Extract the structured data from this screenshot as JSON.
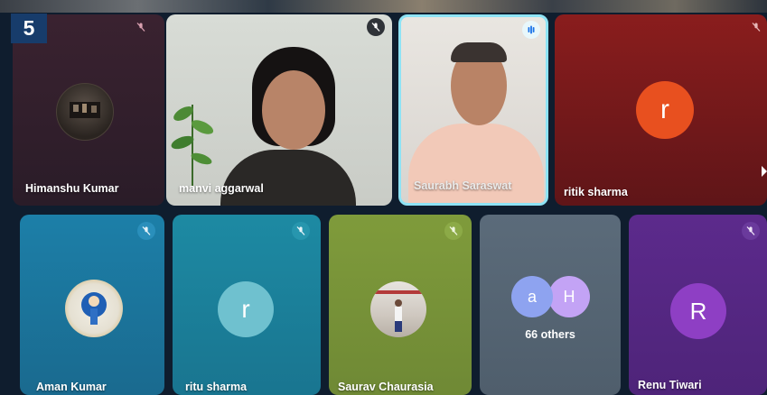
{
  "page_number": "5",
  "participants": {
    "himanshu": {
      "name": "Himanshu Kumar",
      "icon": "mic-off-icon"
    },
    "manvi": {
      "name": "manvi aggarwal",
      "icon": "mic-off-icon"
    },
    "saurabh": {
      "name": "Saurabh Saraswat",
      "icon": "speaking-icon"
    },
    "ritik": {
      "name": "ritik sharma",
      "initial": "r",
      "icon": "mic-off-icon"
    },
    "aman": {
      "name": "Aman Kumar",
      "icon": "mic-off-icon"
    },
    "ritu": {
      "name": "ritu sharma",
      "initial": "r",
      "icon": "mic-off-icon"
    },
    "saurav": {
      "name": "Saurav Chaurasia",
      "icon": "mic-off-icon"
    },
    "others": {
      "initials": [
        "a",
        "H"
      ],
      "label": "66 others"
    },
    "renu": {
      "name": "Renu Tiwari",
      "initial": "R",
      "icon": "mic-off-icon"
    }
  },
  "colors": {
    "accent_speaking": "#8ee3f5",
    "ritik_avatar": "#e8501f",
    "ritu_avatar": "#6fc1cf",
    "renu_avatar": "#8e3fc4",
    "others_a": "#8ea3f0",
    "others_h": "#c3a3f5"
  }
}
